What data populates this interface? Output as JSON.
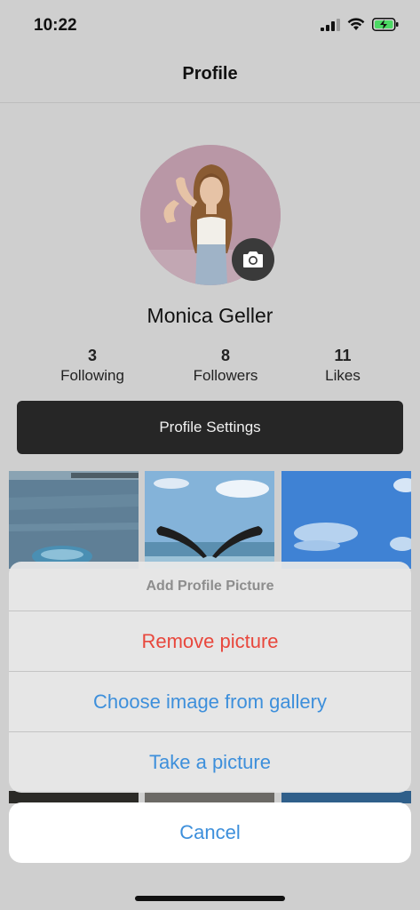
{
  "status_bar": {
    "time": "10:22"
  },
  "nav": {
    "title": "Profile"
  },
  "profile": {
    "name": "Monica Geller",
    "stats": [
      {
        "value": "3",
        "label": "Following"
      },
      {
        "value": "8",
        "label": "Followers"
      },
      {
        "value": "11",
        "label": "Likes"
      }
    ],
    "settings_label": "Profile Settings"
  },
  "action_sheet": {
    "title": "Add Profile Picture",
    "options": [
      {
        "label": "Remove picture",
        "style": "destructive"
      },
      {
        "label": "Choose image from gallery",
        "style": "default"
      },
      {
        "label": "Take a picture",
        "style": "default"
      }
    ],
    "cancel_label": "Cancel"
  },
  "colors": {
    "destructive": "#e8473c",
    "action_blue": "#3d8fdb",
    "settings_button": "#262626"
  }
}
